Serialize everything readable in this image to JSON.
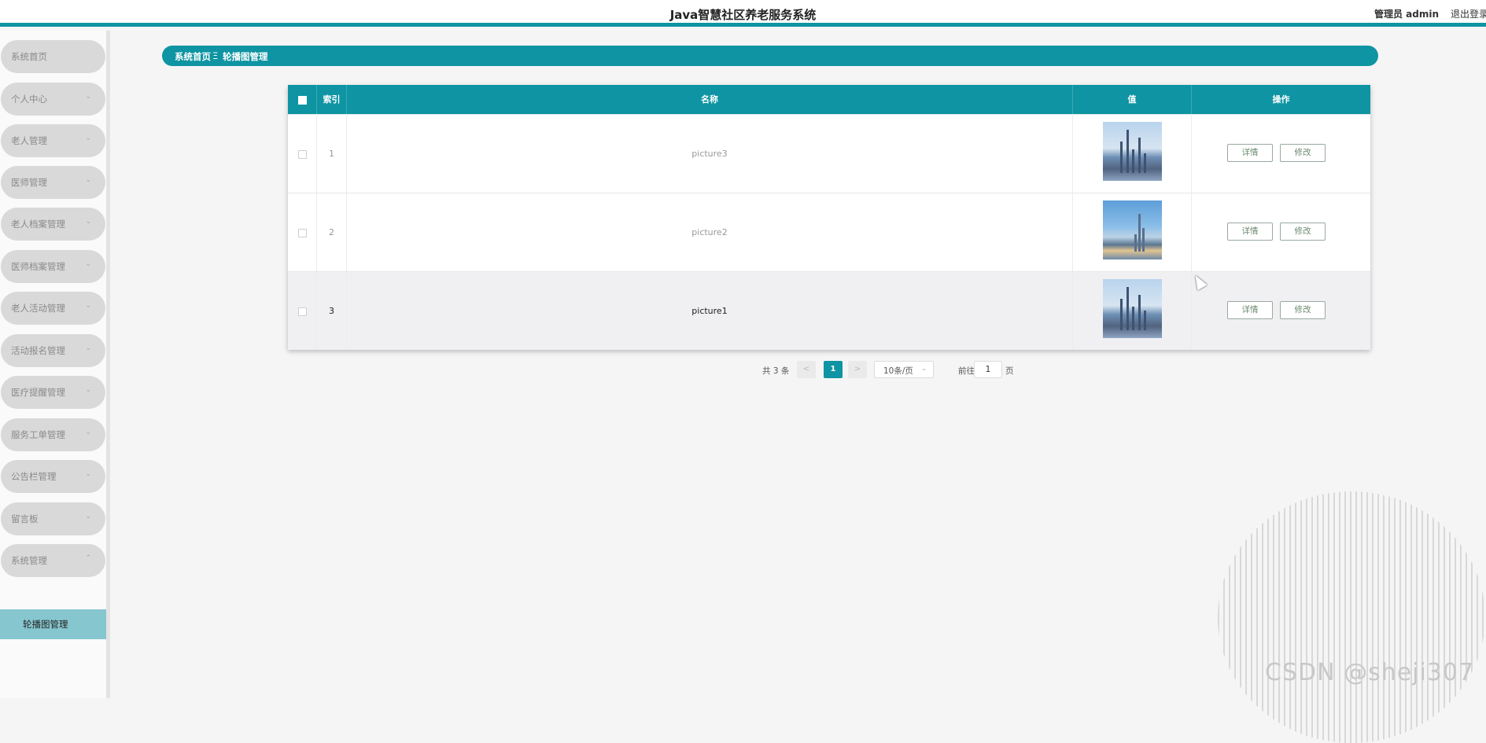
{
  "header": {
    "title": "Java智慧社区养老服务系统",
    "admin_label": "管理员 admin",
    "logout_label": "退出登录"
  },
  "sidebar": {
    "items": [
      {
        "label": "系统首页",
        "chevron": ""
      },
      {
        "label": "个人中心",
        "chevron": "⌄"
      },
      {
        "label": "老人管理",
        "chevron": "⌄"
      },
      {
        "label": "医师管理",
        "chevron": "⌄"
      },
      {
        "label": "老人档案管理",
        "chevron": "⌄"
      },
      {
        "label": "医师档案管理",
        "chevron": "⌄"
      },
      {
        "label": "老人活动管理",
        "chevron": "⌄"
      },
      {
        "label": "活动报名管理",
        "chevron": "⌄"
      },
      {
        "label": "医疗提醒管理",
        "chevron": "⌄"
      },
      {
        "label": "服务工单管理",
        "chevron": "⌄"
      },
      {
        "label": "公告栏管理",
        "chevron": "⌄"
      },
      {
        "label": "留言板",
        "chevron": "⌄"
      },
      {
        "label": "系统管理",
        "chevron": "⌃"
      }
    ],
    "subitem": {
      "label": "轮播图管理"
    }
  },
  "breadcrumb": {
    "home": "系统首页",
    "separator": "Ξ",
    "current": "轮播图管理"
  },
  "table": {
    "columns": [
      "索引",
      "名称",
      "值",
      "操作"
    ],
    "rows": [
      {
        "index": "1",
        "name": "picture3",
        "image": "city-skyline-thumbnail"
      },
      {
        "index": "2",
        "name": "picture2",
        "image": "city-skyline-thumbnail"
      },
      {
        "index": "3",
        "name": "picture1",
        "image": "city-skyline-thumbnail"
      }
    ],
    "detail_label": "详情",
    "edit_label": "修改"
  },
  "pagination": {
    "total_text": "共 3 条",
    "prev": "<",
    "current_page": "1",
    "next": ">",
    "page_size": "10条/页",
    "goto_label": "前往",
    "goto_value": "1",
    "goto_suffix": "页"
  },
  "watermark": "CSDN @sheji307",
  "colors": {
    "accent": "#0e94a2",
    "submenu": "#86c6cf"
  }
}
